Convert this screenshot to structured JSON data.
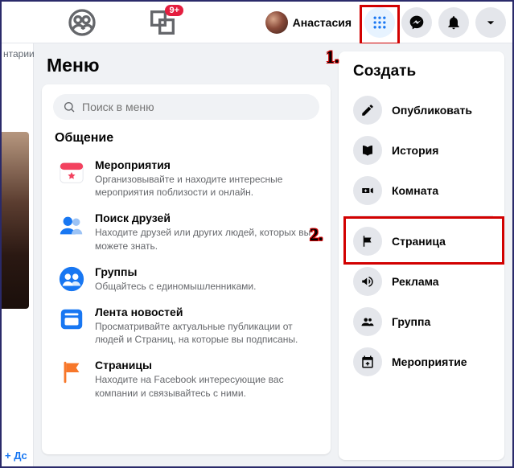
{
  "topbar": {
    "badge": "9+",
    "profile_name": "Анастасия"
  },
  "left_gutter": {
    "truncated_text": "нтарии",
    "add_friend_label": "Дс"
  },
  "menu": {
    "title": "Меню",
    "search_placeholder": "Поиск в меню",
    "section_title": "Общение",
    "items": [
      {
        "title": "Мероприятия",
        "desc": "Организовывайте и находите интересные мероприятия поблизости и онлайн."
      },
      {
        "title": "Поиск друзей",
        "desc": "Находите друзей или других людей, которых вы можете знать."
      },
      {
        "title": "Группы",
        "desc": "Общайтесь с единомышленниками."
      },
      {
        "title": "Лента новостей",
        "desc": "Просматривайте актуальные публикации от людей и Страниц, на которые вы подписаны."
      },
      {
        "title": "Страницы",
        "desc": "Находите на Facebook интересующие вас компании и связывайтесь с ними."
      }
    ]
  },
  "create": {
    "title": "Создать",
    "items_top": [
      {
        "label": "Опубликовать"
      },
      {
        "label": "История"
      },
      {
        "label": "Комната"
      }
    ],
    "items_bottom": [
      {
        "label": "Страница"
      },
      {
        "label": "Реклама"
      },
      {
        "label": "Группа"
      },
      {
        "label": "Мероприятие"
      }
    ]
  },
  "annotations": {
    "one": "1.",
    "two": "2."
  }
}
